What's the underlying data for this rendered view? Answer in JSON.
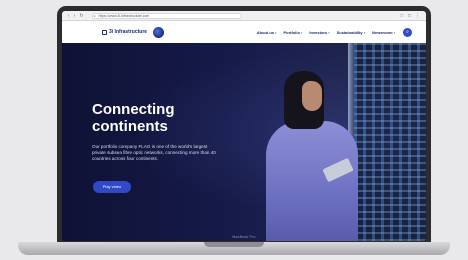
{
  "browser": {
    "url": "https://www.3i-infrastructure.com",
    "icons": [
      "back-icon",
      "forward-icon",
      "reload-icon",
      "star-icon",
      "share-icon",
      "extensions-icon"
    ]
  },
  "site": {
    "logo_text": "3i Infrastructure",
    "menu": [
      "About us ›",
      "Portfolio ›",
      "Investors ›",
      "Sustainability ›",
      "Newsroom ›"
    ]
  },
  "hero": {
    "title_line1": "Connecting",
    "title_line2": "continents",
    "body": "Our portfolio company FLAG is one of the world's largest private subsea fibre optic networks, connecting more than 40 countries across four continents.",
    "button_label": "Play video"
  },
  "device": {
    "label": "MacBook Pro"
  },
  "colors": {
    "brand_navy": "#1e2a6e",
    "accent_blue": "#2f49c8",
    "hero_bg": "#151a48"
  }
}
